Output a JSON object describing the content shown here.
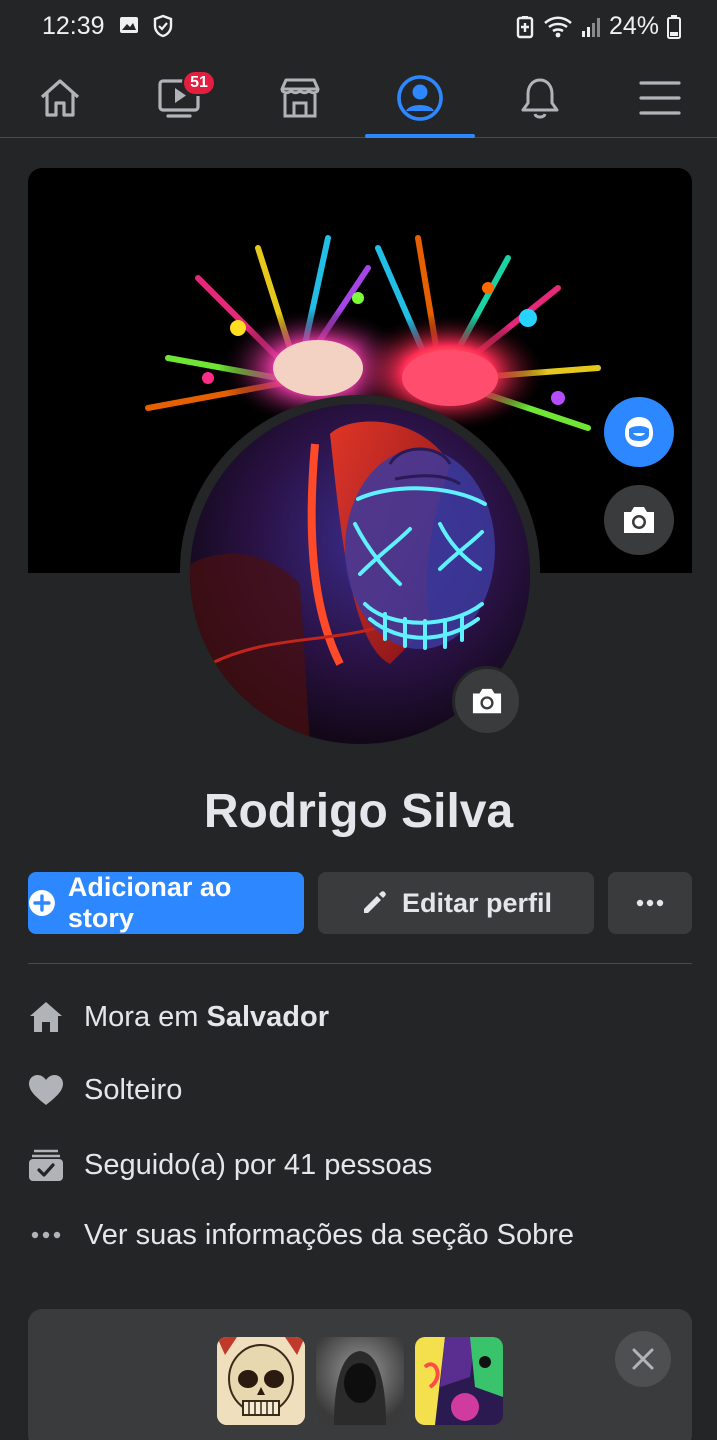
{
  "status_bar": {
    "time": "12:39",
    "battery": "24%"
  },
  "nav": {
    "tabs": [
      {
        "id": "home",
        "icon": "home-icon"
      },
      {
        "id": "watch",
        "icon": "video-icon",
        "badge": "51"
      },
      {
        "id": "marketplace",
        "icon": "store-icon"
      },
      {
        "id": "profile",
        "icon": "profile-icon",
        "active": true
      },
      {
        "id": "notifications",
        "icon": "bell-icon"
      },
      {
        "id": "menu",
        "icon": "hamburger-icon"
      }
    ],
    "accent": "#2d88ff"
  },
  "profile": {
    "name": "Rodrigo Silva",
    "add_story_label": "Adicionar ao story",
    "edit_profile_label": "Editar perfil"
  },
  "info": {
    "lives_prefix": "Mora em ",
    "lives_city": "Salvador",
    "relationship": "Solteiro",
    "followers": "Seguido(a) por 41 pessoas",
    "see_about": "Ver suas informações da seção Sobre"
  },
  "colors": {
    "background": "#242526",
    "surface": "#3a3b3c",
    "primary": "#2d88ff",
    "badge": "#e41e3f"
  }
}
